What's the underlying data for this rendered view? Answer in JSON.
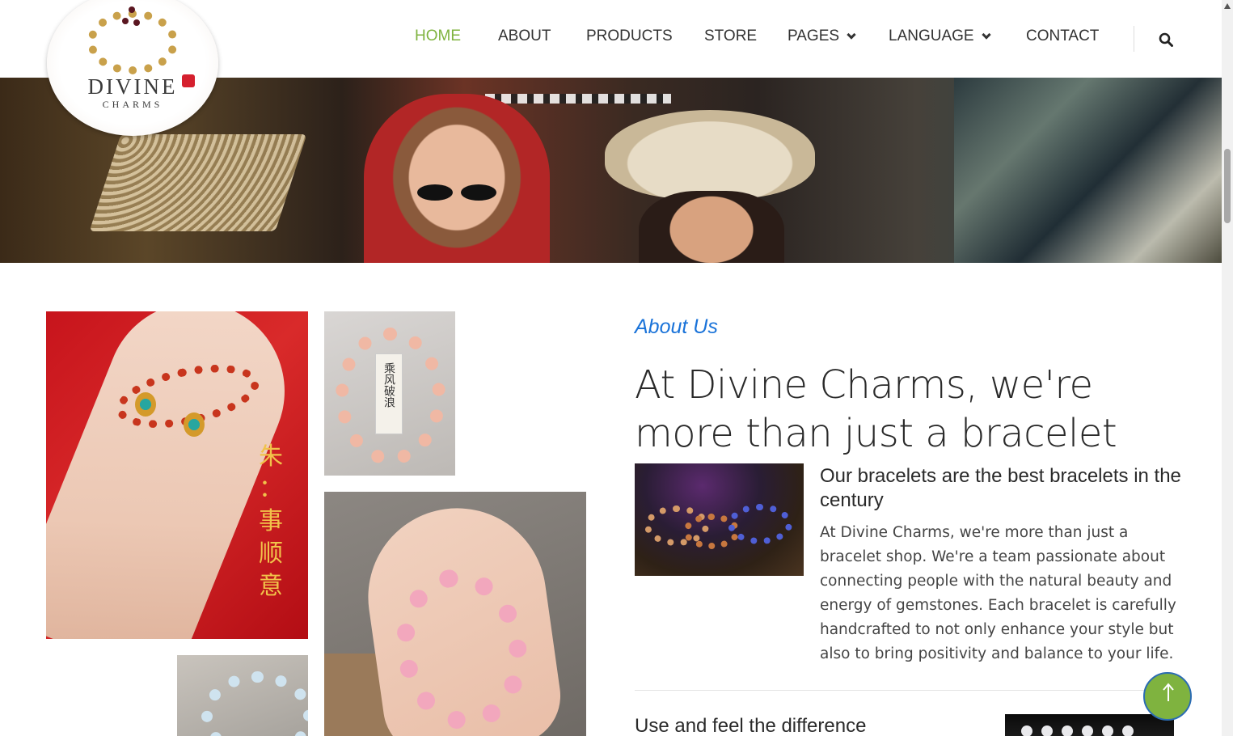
{
  "brand": {
    "name": "DIVINE",
    "tagline": "CHARMS"
  },
  "nav": {
    "items": [
      {
        "label": "HOME",
        "active": true
      },
      {
        "label": "ABOUT"
      },
      {
        "label": "PRODUCTS"
      },
      {
        "label": "STORE"
      },
      {
        "label": "PAGES",
        "dropdown": true
      },
      {
        "label": "LANGUAGE",
        "dropdown": true
      },
      {
        "label": "CONTACT"
      }
    ],
    "search_icon": "search-icon"
  },
  "gallery": {
    "calligraphy": [
      "朱",
      "：",
      "事",
      "顺",
      "意"
    ],
    "tag_text": "乘风破浪"
  },
  "about": {
    "label": "About Us",
    "title": "At Divine Charms, we're more than just a bracelet shop.",
    "subtitle": "Our bracelets are the best bracelets in the century",
    "body": "At Divine Charms, we're more than just a bracelet shop. We're a team passionate about connecting people with the natural beauty and energy of gemstones. Each bracelet is carefully handcrafted to not only enhance your style but also to bring positivity and balance to your life.",
    "next_title": "Use and feel the difference"
  },
  "colors": {
    "accent": "#7fb33f",
    "link": "#1a73d9",
    "text": "#2a2a2a"
  },
  "back_to_top_icon": "arrow-up-icon"
}
